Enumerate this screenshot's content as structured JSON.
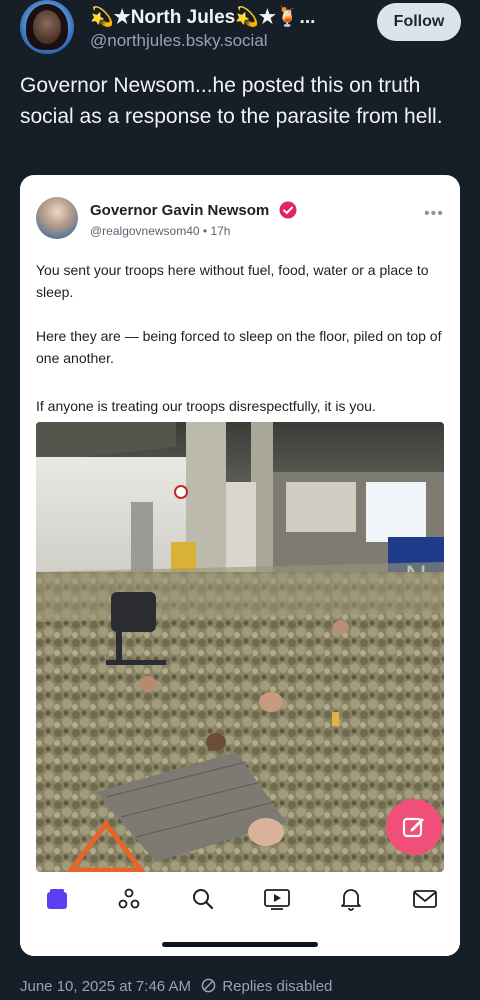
{
  "author": {
    "display_name": "💫★North Jules💫★🍹...",
    "handle": "@northjules.bsky.social",
    "follow_label": "Follow"
  },
  "post": {
    "text": "Governor Newsom...he posted this on truth social as a response to the parasite from hell."
  },
  "embed": {
    "name": "Governor Gavin Newsom",
    "meta": "@realgovnewsom40 • 17h",
    "paragraphs": [
      "You sent your troops here without fuel, food, water or a place to sleep.",
      "Here they are — being forced to sleep on the floor, piled on top of one another.",
      "If anyone is treating our troops disrespectfully, it is you."
    ],
    "more_label": "•••",
    "photo_sign": "N"
  },
  "footer": {
    "timestamp": "June 10, 2025 at 7:46 AM",
    "replies": "Replies disabled"
  },
  "colors": {
    "background": "#161e27",
    "accent_pink": "#ef4f79",
    "tab_active": "#5b3ff0",
    "verified": "#e0245e"
  },
  "icons": {
    "tabs": [
      "home-icon",
      "feeds-icon",
      "search-icon",
      "video-icon",
      "notifications-icon",
      "messages-icon"
    ],
    "fab": "compose-icon"
  }
}
